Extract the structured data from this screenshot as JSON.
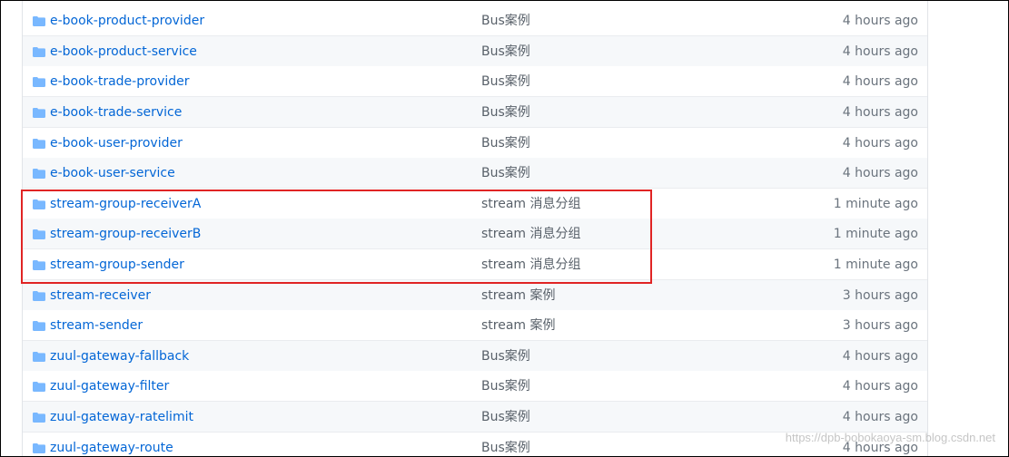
{
  "colors": {
    "link": "#0366d6",
    "folder_icon": "#79b8ff",
    "highlight_border": "#e02424"
  },
  "rows": [
    {
      "icon": "folder-icon",
      "name": "e-book-product-provider",
      "message": "Bus案例",
      "age": "4 hours ago"
    },
    {
      "icon": "folder-icon",
      "name": "e-book-product-service",
      "message": "Bus案例",
      "age": "4 hours ago"
    },
    {
      "icon": "folder-icon",
      "name": "e-book-trade-provider",
      "message": "Bus案例",
      "age": "4 hours ago"
    },
    {
      "icon": "folder-icon",
      "name": "e-book-trade-service",
      "message": "Bus案例",
      "age": "4 hours ago"
    },
    {
      "icon": "folder-icon",
      "name": "e-book-user-provider",
      "message": "Bus案例",
      "age": "4 hours ago"
    },
    {
      "icon": "folder-icon",
      "name": "e-book-user-service",
      "message": "Bus案例",
      "age": "4 hours ago"
    },
    {
      "icon": "folder-icon",
      "name": "stream-group-receiverA",
      "message": "stream 消息分组",
      "age": "1 minute ago"
    },
    {
      "icon": "folder-icon",
      "name": "stream-group-receiverB",
      "message": "stream 消息分组",
      "age": "1 minute ago"
    },
    {
      "icon": "folder-icon",
      "name": "stream-group-sender",
      "message": "stream 消息分组",
      "age": "1 minute ago"
    },
    {
      "icon": "folder-icon",
      "name": "stream-receiver",
      "message": "stream 案例",
      "age": "3 hours ago"
    },
    {
      "icon": "folder-icon",
      "name": "stream-sender",
      "message": "stream 案例",
      "age": "3 hours ago"
    },
    {
      "icon": "folder-icon",
      "name": "zuul-gateway-fallback",
      "message": "Bus案例",
      "age": "4 hours ago"
    },
    {
      "icon": "folder-icon",
      "name": "zuul-gateway-filter",
      "message": "Bus案例",
      "age": "4 hours ago"
    },
    {
      "icon": "folder-icon",
      "name": "zuul-gateway-ratelimit",
      "message": "Bus案例",
      "age": "4 hours ago"
    },
    {
      "icon": "folder-icon",
      "name": "zuul-gateway-route",
      "message": "Bus案例",
      "age": "4 hours ago"
    }
  ],
  "watermark": "https://dpb-bobokaoya-sm.blog.csdn.net"
}
